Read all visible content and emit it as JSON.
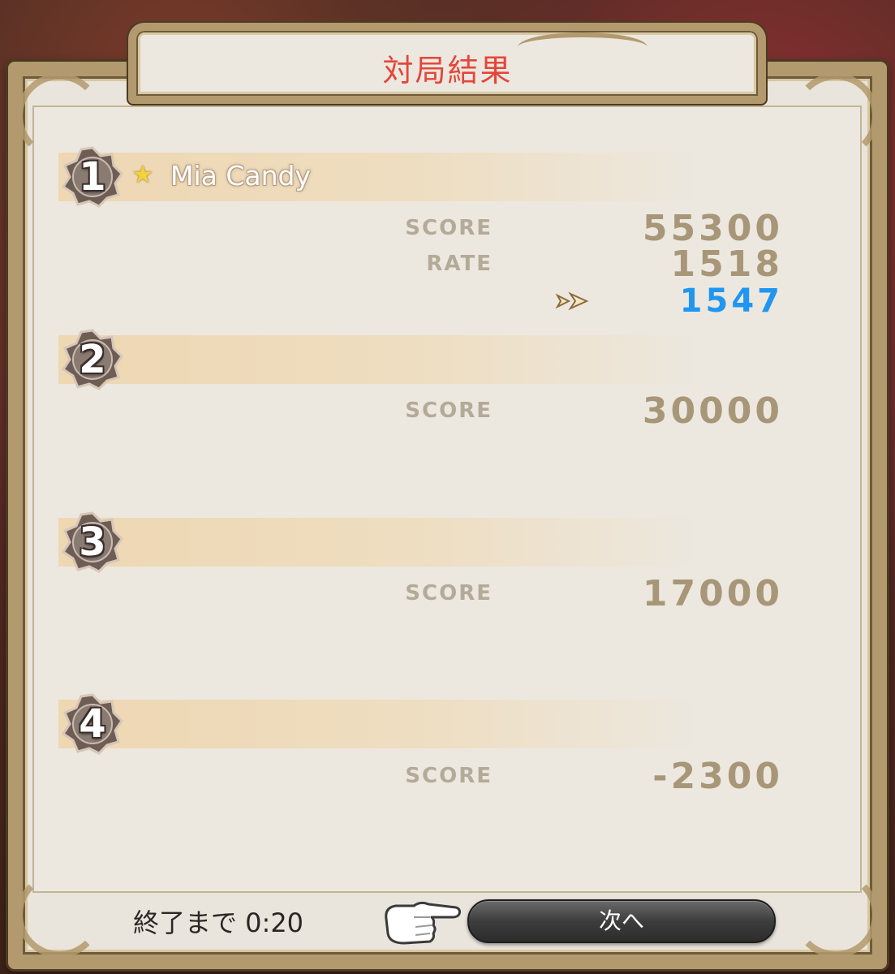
{
  "title": "対局結果",
  "players": [
    {
      "rank": "1",
      "name": "Mia Candy",
      "favorite": true,
      "score_label": "SCORE",
      "score": "55300",
      "rate_label": "RATE",
      "rate": "1518",
      "new_rate": "1547"
    },
    {
      "rank": "2",
      "name": "",
      "score_label": "SCORE",
      "score": "30000"
    },
    {
      "rank": "3",
      "name": "",
      "score_label": "SCORE",
      "score": "17000"
    },
    {
      "rank": "4",
      "name": "",
      "score_label": "SCORE",
      "score": "-2300"
    }
  ],
  "footer": {
    "timer_text": "終了まで 0:20",
    "next_label": "次へ"
  },
  "icons": {
    "star": "star-icon",
    "arrow": "double-chevron-right-icon",
    "pointer": "pointing-hand-icon",
    "badge": "rank-badge-icon"
  },
  "colors": {
    "title": "#e4463a",
    "new_rate": "#2196f0",
    "score": "#a89678"
  }
}
